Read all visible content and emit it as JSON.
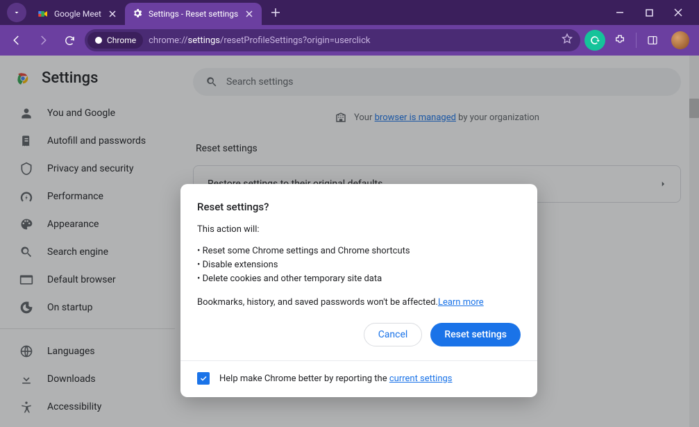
{
  "titlebar": {
    "tabs": [
      {
        "title": "Google Meet",
        "active": false
      },
      {
        "title": "Settings - Reset settings",
        "active": true
      }
    ]
  },
  "toolbar": {
    "chrome_chip": "Chrome",
    "url_prefix": "chrome://",
    "url_strong": "settings",
    "url_suffix": "/resetProfileSettings?origin=userclick"
  },
  "sidebar": {
    "header": "Settings",
    "items_a": [
      "You and Google",
      "Autofill and passwords",
      "Privacy and security",
      "Performance",
      "Appearance",
      "Search engine",
      "Default browser",
      "On startup"
    ],
    "items_b": [
      "Languages",
      "Downloads",
      "Accessibility"
    ]
  },
  "main": {
    "search_placeholder": "Search settings",
    "managed_prefix": "Your ",
    "managed_link": "browser is managed",
    "managed_suffix": " by your organization",
    "section_title": "Reset settings",
    "reset_card": "Restore settings to their original defaults"
  },
  "dialog": {
    "title": "Reset settings?",
    "lead": "This action will:",
    "bullets": [
      "Reset some Chrome settings and Chrome shortcuts",
      "Disable extensions",
      "Delete cookies and other temporary site data"
    ],
    "note_text": "Bookmarks, history, and saved passwords won't be affected.",
    "note_link": "Learn more",
    "cancel": "Cancel",
    "confirm": "Reset settings",
    "footer_text": "Help make Chrome better by reporting the ",
    "footer_link": "current settings"
  }
}
